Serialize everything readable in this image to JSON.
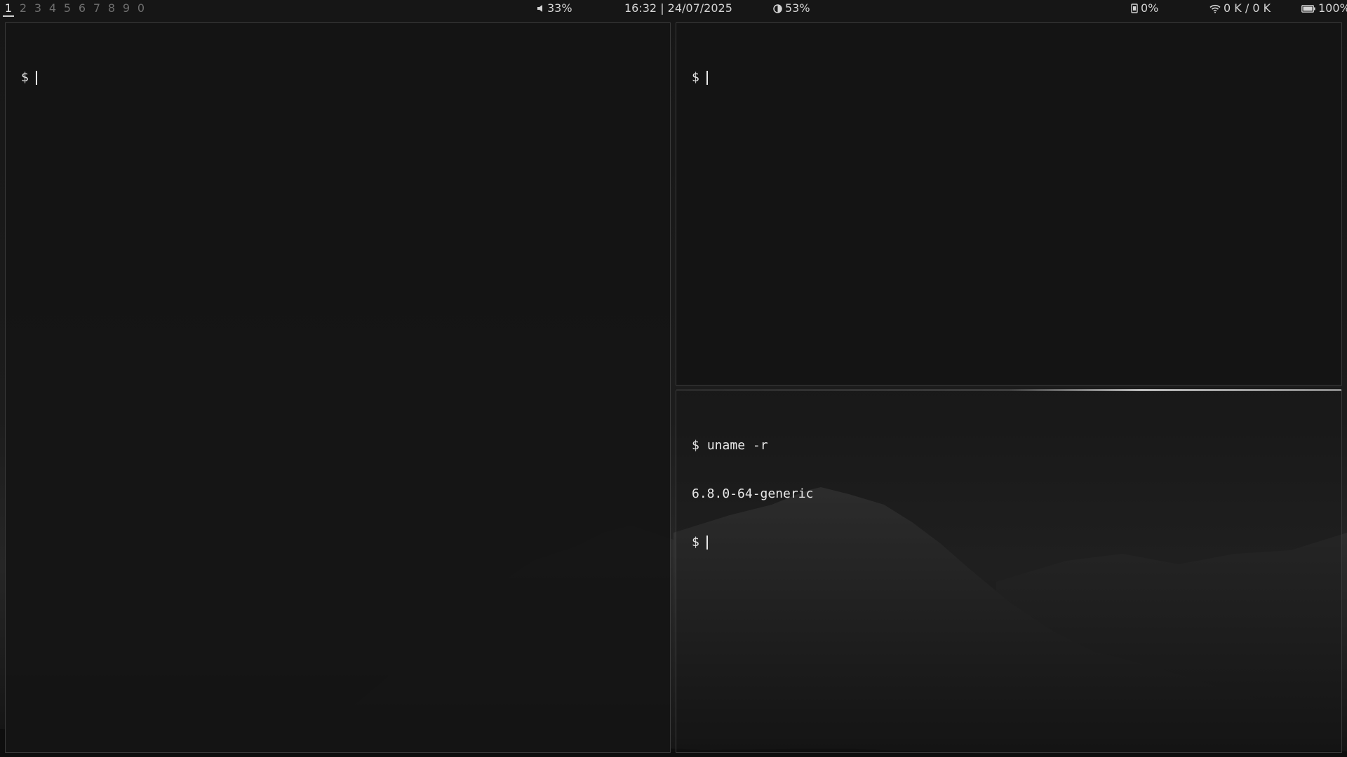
{
  "topbar": {
    "workspaces": [
      "1",
      "2",
      "3",
      "4",
      "5",
      "6",
      "7",
      "8",
      "9",
      "0"
    ],
    "active_workspace": "1",
    "volume": "33%",
    "datetime": "16:32 | 24/07/2025",
    "brightness": "53%",
    "memory": "0%",
    "network": "0 K / 0 K",
    "battery": "100%"
  },
  "terminals": {
    "left": {
      "prompt": "$"
    },
    "top_right": {
      "prompt": "$"
    },
    "bottom_right": {
      "prompt": "$",
      "command": "uname -r",
      "output": "6.8.0-64-generic"
    }
  },
  "icons": {
    "volume": "speaker-icon",
    "brightness": "half-circle-icon",
    "memory": "memory-chip-icon",
    "network": "wifi-icon",
    "battery": "battery-icon"
  }
}
